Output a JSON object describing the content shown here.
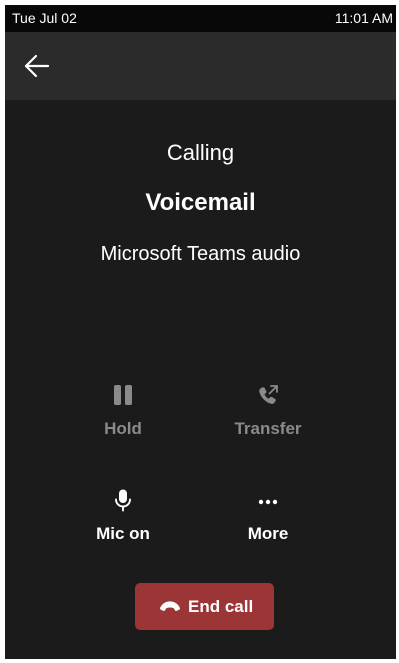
{
  "status_bar": {
    "date": "Tue Jul 02",
    "time": "11:01 AM"
  },
  "header": {
    "back_icon": "arrow-left-icon"
  },
  "call": {
    "status": "Calling",
    "name": "Voicemail",
    "type": "Microsoft Teams audio"
  },
  "controls": {
    "hold": {
      "label": "Hold",
      "icon": "pause-icon",
      "enabled": false
    },
    "transfer": {
      "label": "Transfer",
      "icon": "phone-transfer-icon",
      "enabled": false
    },
    "mic": {
      "label": "Mic on",
      "icon": "microphone-icon",
      "enabled": true
    },
    "more": {
      "label": "More",
      "icon": "more-dots-icon",
      "enabled": true
    }
  },
  "end_call": {
    "label": "End call",
    "icon": "hang-up-icon",
    "color": "#9c3535"
  },
  "colors": {
    "background": "#1b1b1b",
    "header": "#2b2b2b",
    "status_bar": "#080808",
    "text": "#ffffff",
    "disabled_text": "#8a8a8a"
  }
}
